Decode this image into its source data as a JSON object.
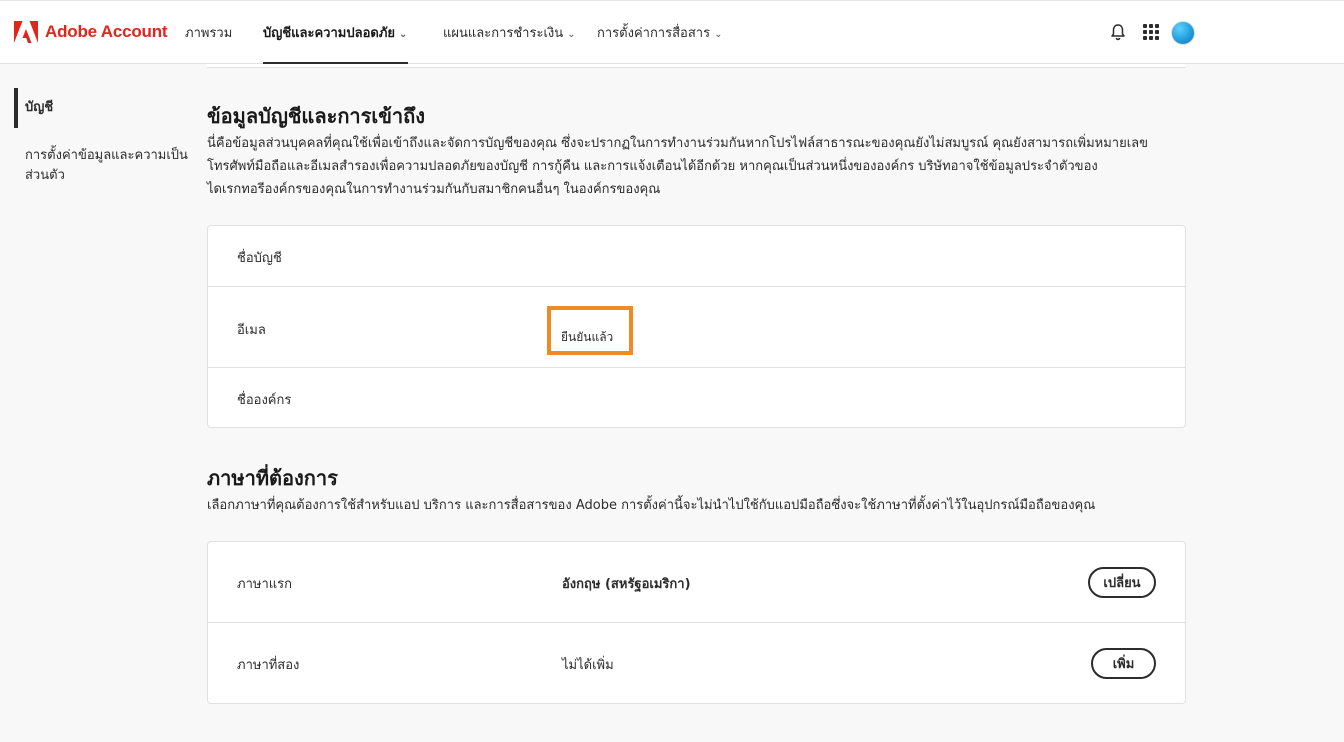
{
  "header": {
    "brand": "Adobe Account",
    "nav": [
      {
        "label": "ภาพรวม"
      },
      {
        "label": "บัญชีและความปลอดภัย"
      },
      {
        "label": "แผนและการชำระเงิน"
      },
      {
        "label": "การตั้งค่าการสื่อสาร"
      }
    ]
  },
  "sidebar": {
    "items": [
      {
        "label": "บัญชี"
      },
      {
        "label": "การตั้งค่าข้อมูลและความเป็น"
      },
      {
        "label": "ส่วนตัว"
      }
    ]
  },
  "account_section": {
    "title": "ข้อมูลบัญชีและการเข้าถึง",
    "desc_line1": "นี่คือข้อมูลส่วนบุคคลที่คุณใช้เพื่อเข้าถึงและจัดการบัญชีของคุณ ซึ่งจะปรากฏในการทำงานร่วมกันหากโปรไฟล์สาธารณะของคุณยังไม่สมบูรณ์ คุณยังสามารถเพิ่มหมายเลข",
    "desc_line2": "โทรศัพท์มือถือและอีเมลสำรองเพื่อความปลอดภัยของบัญชี การกู้คืน และการแจ้งเตือนได้อีกด้วย หากคุณเป็นส่วนหนึ่งขององค์กร บริษัทอาจใช้ข้อมูลประจำตัวของ",
    "desc_line3": "ไดเรกทอรีองค์กรของคุณในการทำงานร่วมกันกับสมาชิกคนอื่นๆ ในองค์กรของคุณ",
    "rows": [
      {
        "label": "ชื่อบัญชี",
        "value": ""
      },
      {
        "label": "อีเมล",
        "value": "ยืนยันแล้ว"
      },
      {
        "label": "ชื่อองค์กร",
        "value": ""
      }
    ]
  },
  "language_section": {
    "title": "ภาษาที่ต้องการ",
    "desc": "เลือกภาษาที่คุณต้องการใช้สำหรับแอป บริการ และการสื่อสารของ Adobe การตั้งค่านี้จะไม่นำไปใช้กับแอปมือถือซึ่งจะใช้ภาษาที่ตั้งค่าไว้ในอุปกรณ์มือถือของคุณ",
    "rows": [
      {
        "label": "ภาษาแรก",
        "value": "อังกฤษ (สหรัฐอเมริกา)",
        "button": "เปลี่ยน"
      },
      {
        "label": "ภาษาที่สอง",
        "value": "ไม่ได้เพิ่ม",
        "button": "เพิ่ม"
      }
    ]
  },
  "colors": {
    "brand": "#e1251b",
    "highlight": "#f08a24"
  }
}
